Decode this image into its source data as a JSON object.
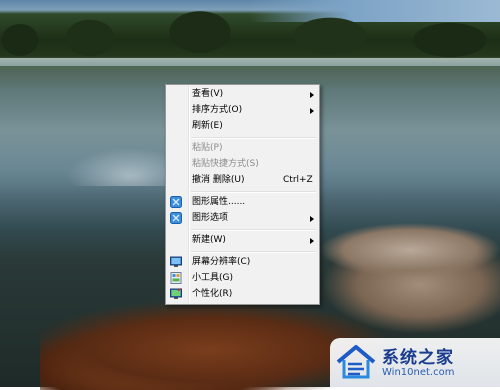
{
  "context_menu": {
    "items": [
      {
        "label": "查看(V)",
        "submenu": true
      },
      {
        "label": "排序方式(O)",
        "submenu": true
      },
      {
        "label": "刷新(E)"
      },
      {
        "label": "粘贴(P)",
        "disabled": true
      },
      {
        "label": "粘贴快捷方式(S)",
        "disabled": true
      },
      {
        "label": "撤消 删除(U)",
        "shortcut": "Ctrl+Z"
      },
      {
        "label": "图形属性......",
        "icon": "intel-graphics-icon"
      },
      {
        "label": "图形选项",
        "icon": "intel-graphics-icon",
        "submenu": true
      },
      {
        "label": "新建(W)",
        "submenu": true
      },
      {
        "label": "屏幕分辨率(C)",
        "icon": "monitor-icon"
      },
      {
        "label": "小工具(G)",
        "icon": "gadgets-icon"
      },
      {
        "label": "个性化(R)",
        "icon": "personalize-icon"
      }
    ]
  },
  "watermark": {
    "title": "系统之家",
    "url": "Win10net.com"
  }
}
